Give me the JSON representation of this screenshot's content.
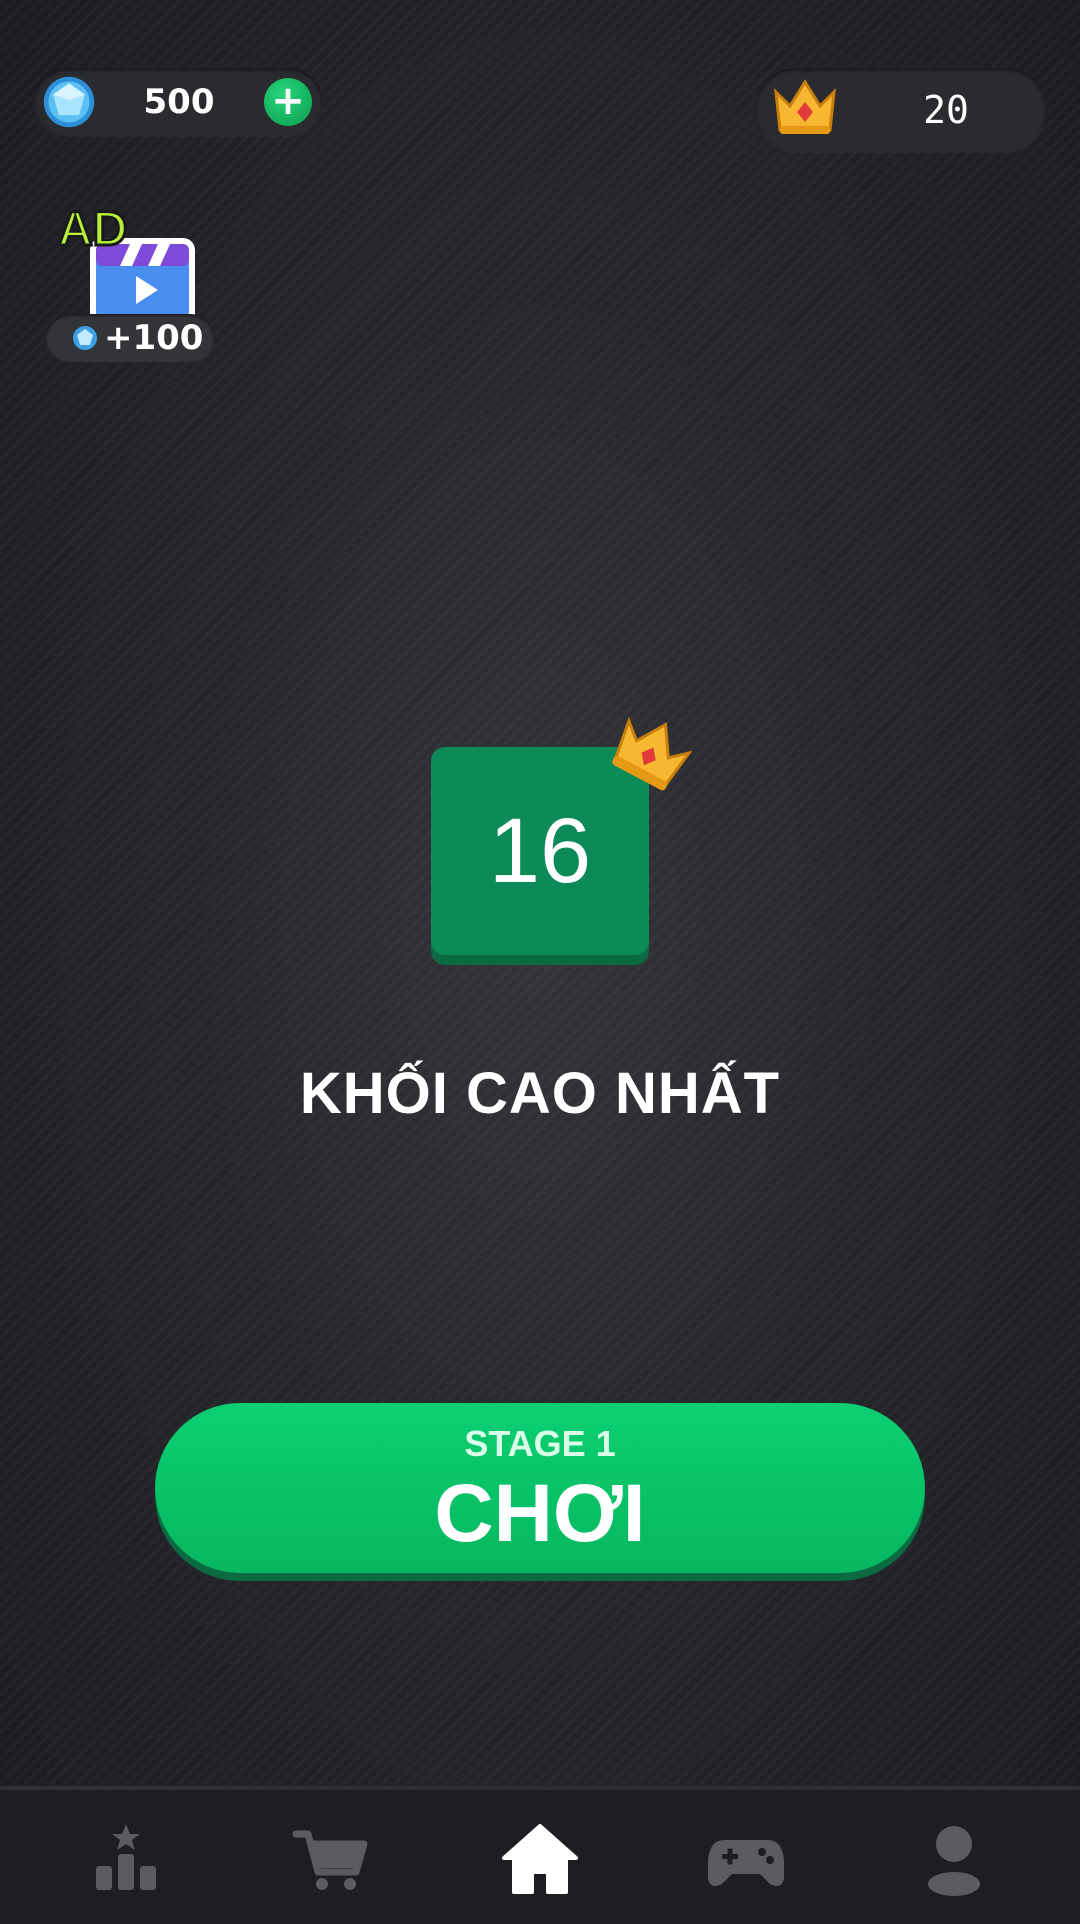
{
  "currency": {
    "gems": "500",
    "add_label": "+"
  },
  "crowns": {
    "count": "20"
  },
  "ad_reward": {
    "badge": "AD",
    "reward_text": "+100"
  },
  "highest_block": {
    "value": "16",
    "label": "KHỐI CAO NHẤT"
  },
  "play": {
    "stage_label": "STAGE 1",
    "button_label": "CHƠI"
  },
  "nav": {
    "items": [
      {
        "icon": "leaderboard-icon",
        "active": false
      },
      {
        "icon": "cart-icon",
        "active": false
      },
      {
        "icon": "home-icon",
        "active": true
      },
      {
        "icon": "gamepad-icon",
        "active": false
      },
      {
        "icon": "profile-icon",
        "active": false
      }
    ]
  },
  "colors": {
    "accent_green": "#07b75f",
    "tile_green": "#0c8a57",
    "crown_gold": "#f7b731",
    "gem_blue": "#4fb3f0",
    "nav_inactive": "#5b5c60",
    "nav_active": "#ffffff"
  }
}
